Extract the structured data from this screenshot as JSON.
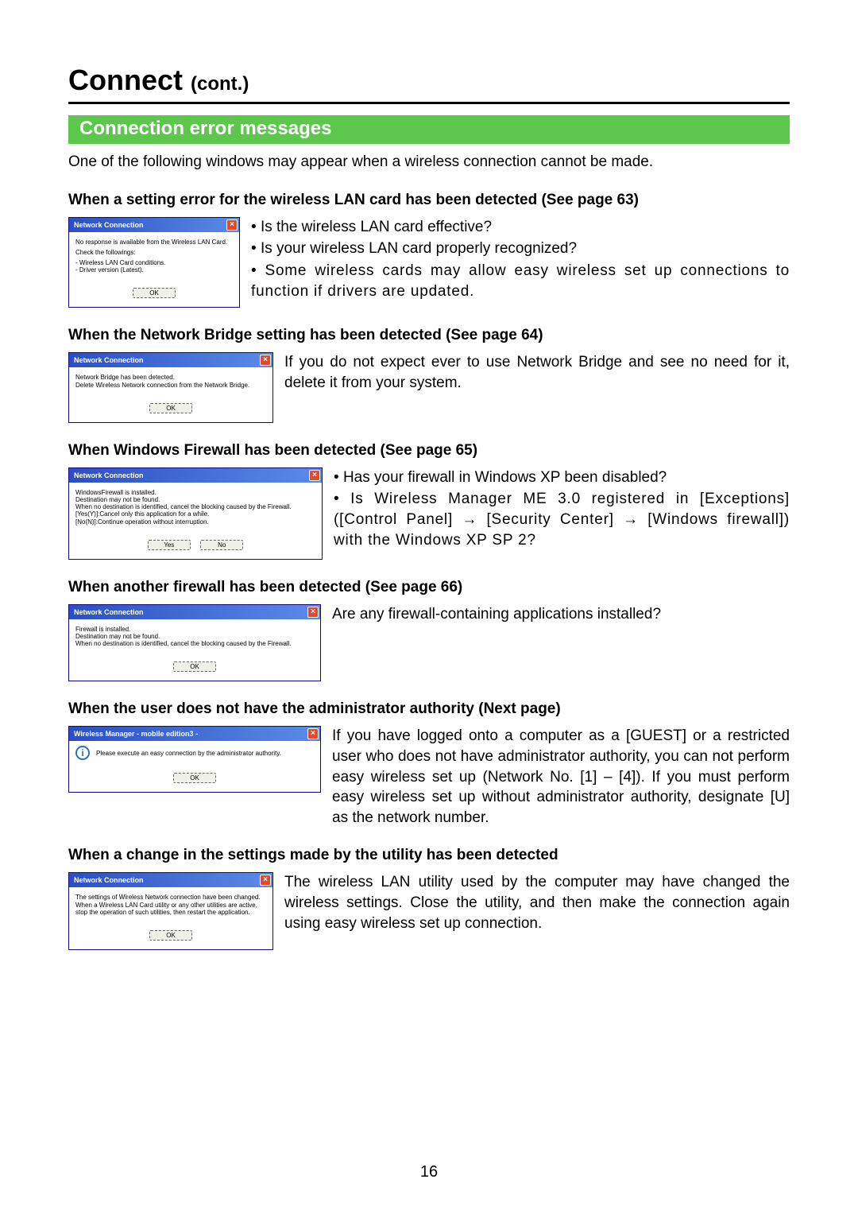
{
  "page_title_main": "Connect",
  "page_title_cont": "(cont.)",
  "green_heading": "Connection error messages",
  "intro": "One of the following windows may appear when a wireless connection cannot be made.",
  "dialog_title_nc": "Network Connection",
  "dialog_title_wm": "Wireless Manager - mobile edition3 -",
  "btn_ok": "OK",
  "btn_yes": "Yes",
  "btn_no": "No",
  "sec1": {
    "heading": "When a setting error for the wireless LAN card has been detected (See page 63)",
    "dlg_lines": [
      "No response is available from the Wireless LAN Card.",
      "Check the followings:",
      "- Wireless LAN Card conditions.",
      "- Driver version (Latest)."
    ],
    "bullets": [
      "Is the wireless LAN card effective?",
      "Is your wireless LAN card properly recognized?",
      "Some wireless cards may allow easy wireless set up connections to function if drivers are updated."
    ]
  },
  "sec2": {
    "heading": "When the Network Bridge setting has been detected (See page 64)",
    "dlg_lines": [
      "Network Bridge has been detected.",
      "Delete Wireless Network connection from the Network Bridge."
    ],
    "text": "If you do not expect ever to use Network Bridge and see no need for it, delete it from your system."
  },
  "sec3": {
    "heading": "When Windows Firewall has been detected (See page 65)",
    "dlg_lines": [
      "WindowsFirewall is installed.",
      "Destination may not be found.",
      "When no destination is identified, cancel the blocking caused by the Firewall.",
      "[Yes(Y)]:Cancel only this application for a while.",
      "[No(N)]:Continue operation without interruption."
    ],
    "bullets": [
      "Has your firewall in Windows XP been disabled?",
      "Is Wireless Manager ME 3.0 registered in [Exceptions] ([Control Panel] → [Security Center] → [Windows firewall]) with the Windows XP SP 2?"
    ]
  },
  "sec4": {
    "heading": "When another firewall has been detected (See page 66)",
    "dlg_lines": [
      "Firewall is installed.",
      "Destination may not be found.",
      "When no destination is identified, cancel the blocking caused by the Firewall."
    ],
    "text": "Are any firewall-containing applications installed?"
  },
  "sec5": {
    "heading": "When the user does not have the administrator authority (Next page)",
    "dlg_text": "Please execute an easy connection by the administrator authority.",
    "text": "If you have logged onto a computer as a [GUEST] or a restricted user who does not have administrator authority, you can not perform easy wireless set up (Network No. [1] – [4]). If you must perform easy wireless set up without administrator authority, designate [U] as the network number."
  },
  "sec6": {
    "heading": "When a change in the settings made by the utility has been detected",
    "dlg_lines": [
      "The settings of Wireless Network connection have been changed.",
      "When a Wireless LAN Card utility or any other utilities are active,",
      "stop the operation of such utilities, then restart the application."
    ],
    "text": "The wireless LAN utility used by the computer may have changed the wireless settings. Close the utility, and then make the connection again using easy wireless set up connection."
  },
  "page_number": "16"
}
